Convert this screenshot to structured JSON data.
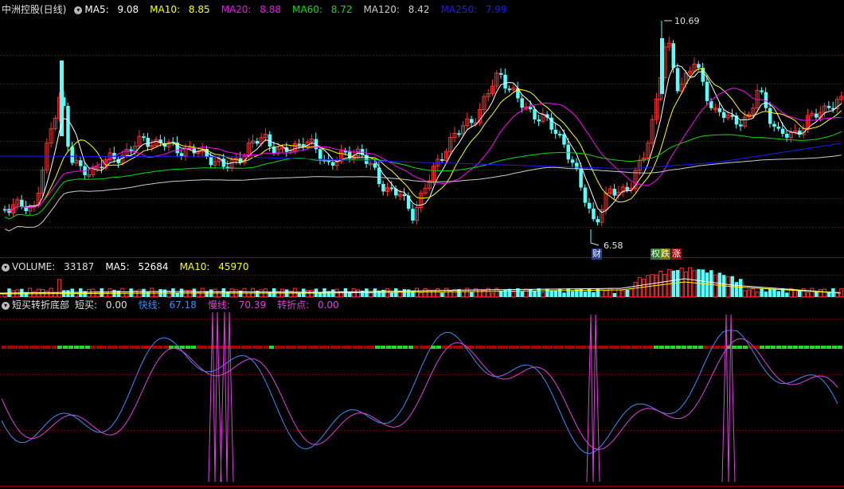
{
  "colors": {
    "up": "#ff3232",
    "down": "#54ffff",
    "grid": "#8a0000",
    "separator": "#a00000",
    "ma5": "#ffffff",
    "ma10": "#ffff00",
    "ma20": "#ff00ff",
    "ma60": "#00e000",
    "ma120": "#cccccc",
    "ma250": "#1a1aff",
    "fast": "#3a8cff",
    "slow": "#e040e0",
    "redBar": "#b00000",
    "greenBar": "#22dd22"
  },
  "main": {
    "title": "中洲控股(日线)",
    "ma5": {
      "label": "MA5:",
      "value": "9.08"
    },
    "ma10": {
      "label": "MA10:",
      "value": "8.85"
    },
    "ma20": {
      "label": "MA20:",
      "value": "8.88"
    },
    "ma60": {
      "label": "MA60:",
      "value": "8.72"
    },
    "ma120": {
      "label": "MA120:",
      "value": "8.42"
    },
    "ma250": {
      "label": "MA250:",
      "value": "7.99"
    },
    "high_label": "10.69",
    "low_label": "6.58",
    "tags": [
      "财",
      "权",
      "跌",
      "涨"
    ]
  },
  "volume": {
    "title": "VOLUME:",
    "value": "33187",
    "ma5_label": "MA5:",
    "ma5": "52684",
    "ma10_label": "MA10:",
    "ma10": "45970"
  },
  "indicator": {
    "title": "短买转折底部",
    "buy_label": "短买:",
    "buy": "0.00",
    "fast_label": "快线:",
    "fast": "67.18",
    "slow_label": "慢线:",
    "slow": "70.39",
    "turn_label": "转折点:",
    "turn": "0.00"
  }
}
